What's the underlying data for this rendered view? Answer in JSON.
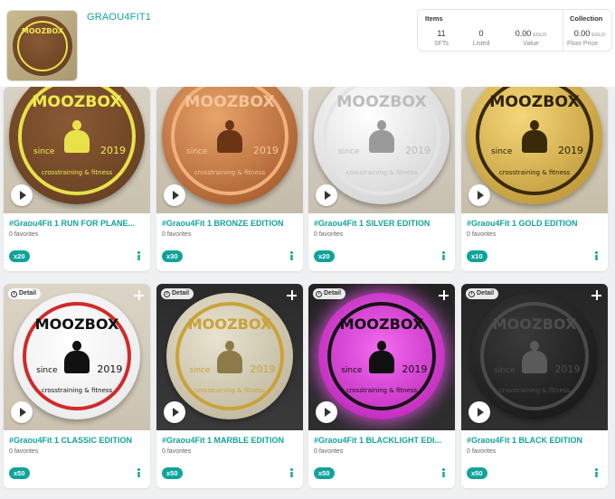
{
  "collection": {
    "name": "GRAOU4FIT1"
  },
  "stats": {
    "items_heading": "Items",
    "collection_heading": "Collection",
    "sfts_value": "11",
    "sfts_label": "SFTs",
    "listed_value": "0",
    "listed_label": "Listed",
    "value_amount": "0.00",
    "value_unit": "EGLD",
    "value_label": "Value",
    "floor_amount": "0.00",
    "floor_unit": "EGLD",
    "floor_label": "Floor Price"
  },
  "medal_text": {
    "brand": "MOOZBOX",
    "since": "since",
    "year": "2019",
    "sub": "crosstraining & fitness"
  },
  "cards": [
    {
      "title": "#Graou4Fit 1 RUN FOR PLANE...",
      "favorites": "0 favorites",
      "qty": "x20",
      "variant": "yellow-wood"
    },
    {
      "title": "#Graou4Fit 1 BRONZE EDITION",
      "favorites": "0 favorites",
      "qty": "x30",
      "variant": "bronze"
    },
    {
      "title": "#Graou4Fit 1 SILVER EDITION",
      "favorites": "0 favorites",
      "qty": "x20",
      "variant": "silver"
    },
    {
      "title": "#Graou4Fit 1 GOLD EDITION",
      "favorites": "0 favorites",
      "qty": "x10",
      "variant": "gold"
    },
    {
      "title": "#Graou4Fit 1 CLASSIC EDITION",
      "favorites": "0 favorites",
      "qty": "x50",
      "variant": "classic",
      "detail": "Detail"
    },
    {
      "title": "#Graou4Fit 1 MARBLE EDITION",
      "favorites": "0 favorites",
      "qty": "x50",
      "variant": "marble",
      "detail": "Detail"
    },
    {
      "title": "#Graou4Fit 1 BLACKLIGHT EDI...",
      "favorites": "0 favorites",
      "qty": "x50",
      "variant": "blacklight",
      "detail": "Detail"
    },
    {
      "title": "#Graou4Fit 1 BLACK EDITION",
      "favorites": "0 favorites",
      "qty": "x50",
      "variant": "black",
      "detail": "Detail"
    }
  ],
  "colors": {
    "accent": "#12a39a"
  }
}
